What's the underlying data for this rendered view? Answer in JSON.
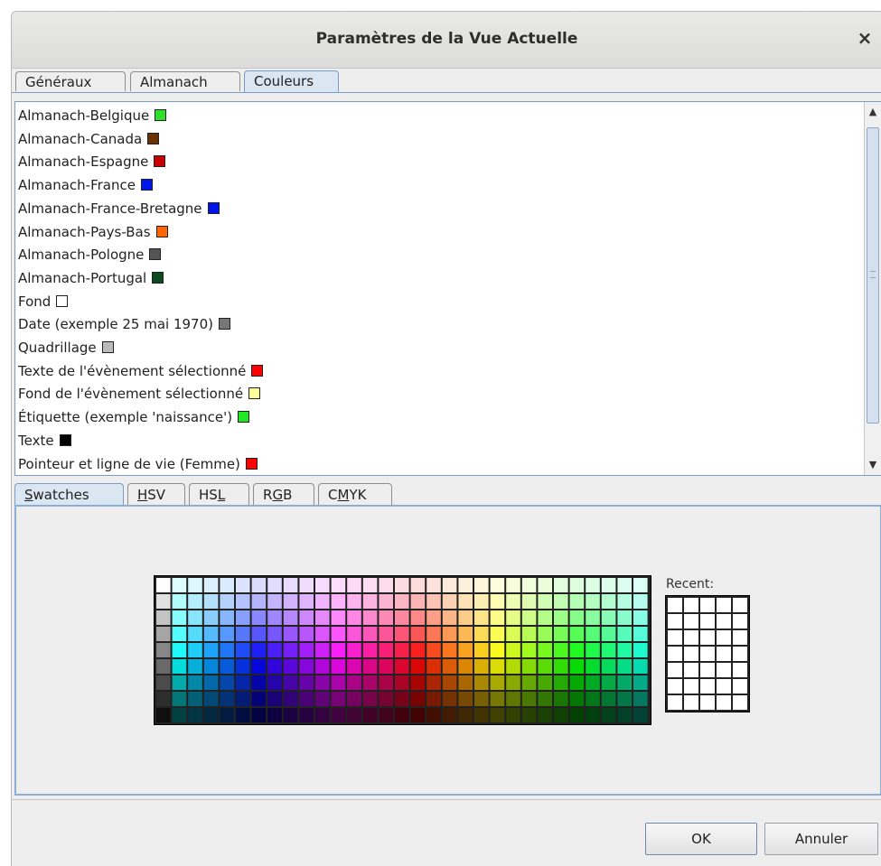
{
  "dialog": {
    "title": "Paramètres de la Vue Actuelle",
    "close_glyph": "×"
  },
  "tabs": [
    {
      "label": "Généraux",
      "active": false
    },
    {
      "label": "Almanach",
      "active": false
    },
    {
      "label": "Couleurs",
      "active": true
    }
  ],
  "color_items": [
    {
      "label": "Almanach-Belgique",
      "color": "#2ee02e"
    },
    {
      "label": "Almanach-Canada",
      "color": "#6a3200"
    },
    {
      "label": "Almanach-Espagne",
      "color": "#c80000"
    },
    {
      "label": "Almanach-France",
      "color": "#0016e8"
    },
    {
      "label": "Almanach-France-Bretagne",
      "color": "#0016e8"
    },
    {
      "label": "Almanach-Pays-Bas",
      "color": "#ff6600"
    },
    {
      "label": "Almanach-Pologne",
      "color": "#555555"
    },
    {
      "label": "Almanach-Portugal",
      "color": "#0a4a1e"
    },
    {
      "label": "Fond",
      "color": "#ffffff"
    },
    {
      "label": "Date (exemple 25 mai 1970)",
      "color": "#777777"
    },
    {
      "label": "Quadrillage",
      "color": "#bbbbbb"
    },
    {
      "label": "Texte de l'évènement sélectionné",
      "color": "#ff0000"
    },
    {
      "label": "Fond de l'évènement sélectionné",
      "color": "#ffff99"
    },
    {
      "label": "Étiquette (exemple 'naissance')",
      "color": "#22e822"
    },
    {
      "label": "Texte",
      "color": "#000000"
    },
    {
      "label": "Pointeur et ligne de vie (Femme)",
      "color": "#ff0000"
    }
  ],
  "scrollbar": {
    "up_glyph": "▲",
    "down_glyph": "▼"
  },
  "chooser_tabs": [
    {
      "label": "Swatches",
      "mnemonic_index": 0,
      "active": true
    },
    {
      "label": "HSV",
      "mnemonic_index": 0,
      "active": false
    },
    {
      "label": "HSL",
      "mnemonic_index": 2,
      "active": false
    },
    {
      "label": "RGB",
      "mnemonic_index": 1,
      "active": false
    },
    {
      "label": "CMYK",
      "mnemonic_index": 1,
      "active": false
    }
  ],
  "recent_label": "Recent:",
  "buttons": {
    "ok": "OK",
    "cancel": "Annuler"
  }
}
